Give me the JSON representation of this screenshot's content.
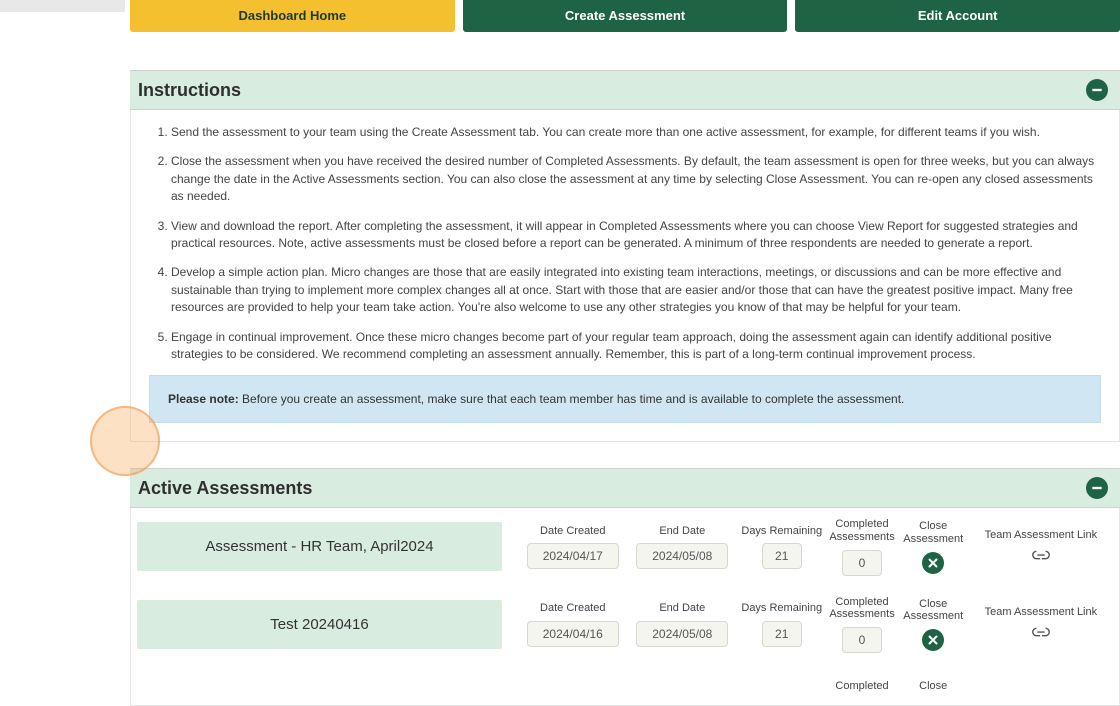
{
  "tabs": {
    "home": "Dashboard Home",
    "create": "Create Assessment",
    "edit": "Edit Account"
  },
  "instructionsHeader": "Instructions",
  "instructions": {
    "i1": "Send the assessment to your team using the Create Assessment tab. You can create more than one active assessment, for example, for different teams if you wish.",
    "i2": "Close the assessment when you have received the desired number of Completed Assessments. By default, the team assessment is open for three weeks, but you can always change the date in the Active Assessments section. You can also close the assessment at any time by selecting Close Assessment. You can re-open any closed assessments as needed.",
    "i3": "View and download the report. After completing the assessment, it will appear in Completed Assessments where you can choose View Report for suggested strategies and practical resources. Note, active assessments must be closed before a report can be generated. A minimum of three respondents are needed to generate a report.",
    "i4": "Develop a simple action plan. Micro changes are those that are easily integrated into existing team interactions, meetings, or discussions and can be more effective and sustainable than trying to implement more complex changes all at once. Start with those that are easier and/or those that can have the greatest positive impact. Many free resources are provided to help your team take action. You're also welcome to use any other strategies you know of that may be helpful for your team.",
    "i5": "Engage in continual improvement. Once these micro changes become part of your regular team approach, doing the assessment again can identify additional positive strategies to be considered. We recommend completing an assessment annually. Remember, this is part of a long-term continual improvement process."
  },
  "notePrefix": "Please note:",
  "noteText": " Before you create an assessment, make sure that each team member has time and is available to complete the assessment.",
  "activeHeader": "Active Assessments",
  "colLabels": {
    "dateCreated": "Date Created",
    "endDate": "End Date",
    "daysRemaining": "Days Remaining",
    "completed": "Completed Assessments",
    "close": "Close Assessment",
    "link": "Team Assessment Link"
  },
  "assessments": [
    {
      "name": "Assessment - HR Team, April2024",
      "dateCreated": "2024/04/17",
      "endDate": "2024/05/08",
      "daysRemaining": "21",
      "completed": "0"
    },
    {
      "name": "Test 20240416",
      "dateCreated": "2024/04/16",
      "endDate": "2024/05/08",
      "daysRemaining": "21",
      "completed": "0"
    }
  ],
  "partialLabels": {
    "completed": "Completed",
    "close": "Close"
  }
}
